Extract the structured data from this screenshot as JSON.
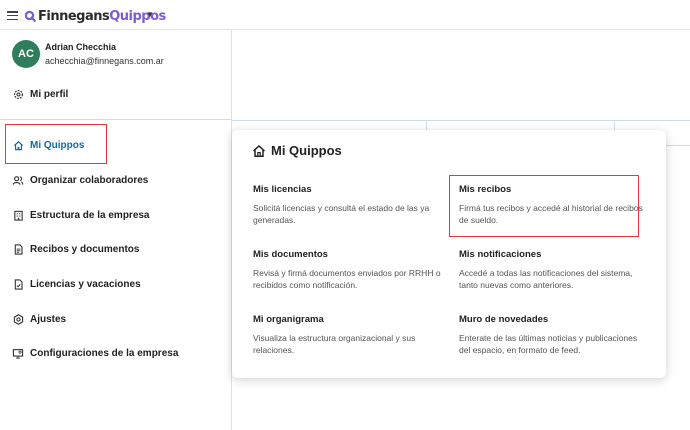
{
  "app": {
    "brand_part1": "Finnegans",
    "brand_part2": "Quippos"
  },
  "user": {
    "initials": "AC",
    "name": "Adrian Checchia",
    "email": "achecchia@finnegans.com.ar"
  },
  "sidebar": {
    "profile": "Mi perfil",
    "items": [
      {
        "label": "Mi Quippos"
      },
      {
        "label": "Organizar colaboradores"
      },
      {
        "label": "Estructura de la empresa"
      },
      {
        "label": "Recibos y documentos"
      },
      {
        "label": "Licencias y vacaciones"
      },
      {
        "label": "Ajustes"
      },
      {
        "label": "Configuraciones de la empresa"
      }
    ]
  },
  "panel": {
    "title": "Mi Quippos",
    "cards": [
      {
        "title": "Mis licencias",
        "desc": "Solicitá licencias y consultá el estado de las ya generadas."
      },
      {
        "title": "Mis recibos",
        "desc": "Firmá tus recibos y accedé al historial de recibos de sueldo."
      },
      {
        "title": "Mis documentos",
        "desc": "Revisá y firmá documentos enviados por RRHH o recibidos como notificación."
      },
      {
        "title": "Mis notificaciones",
        "desc": "Accedé a todas las notificaciones del sistema, tanto nuevas como anteriores."
      },
      {
        "title": "Mi organigrama",
        "desc": "Visualiza la estructura organizacional y sus relaciones."
      },
      {
        "title": "Muro de novedades",
        "desc": "Enterate de las últimas noticias y publicaciones del espacio, en formato de feed."
      }
    ]
  },
  "colors": {
    "accent": "#0d6aa8",
    "brand_purple": "#7b5cd6",
    "avatar_bg": "#2e7d5b",
    "highlight": "#e53935"
  }
}
